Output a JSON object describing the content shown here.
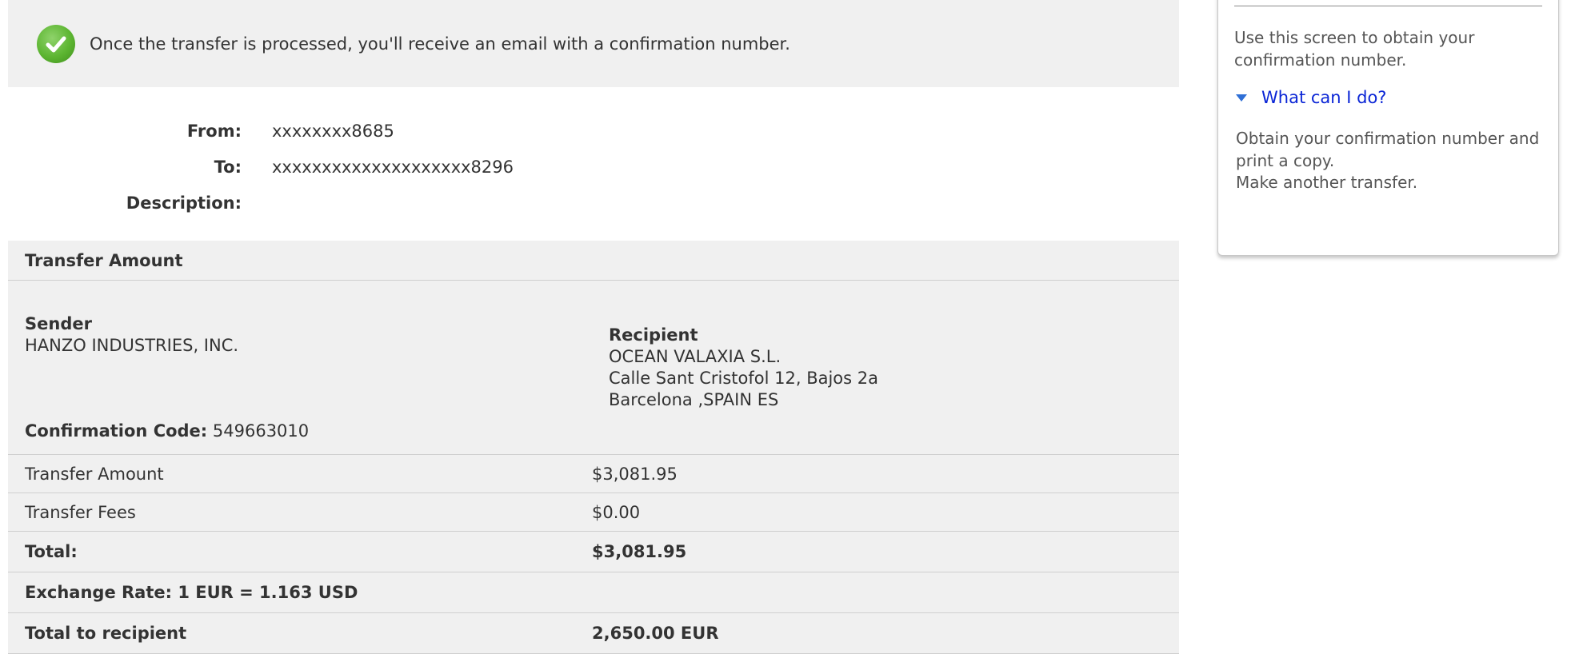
{
  "notice": {
    "text": "Once the transfer is processed, you'll receive an email with a confirmation number.",
    "icon": "checkmark-icon",
    "icon_color": "#5cb531"
  },
  "fields": {
    "from_label": "From:",
    "from_value": "xxxxxxxx8685",
    "to_label": "To:",
    "to_value": "xxxxxxxxxxxxxxxxxxxx8296",
    "description_label": "Description:",
    "description_value": ""
  },
  "summary": {
    "header": "Transfer Amount",
    "sender": {
      "label": "Sender",
      "name": "HANZO INDUSTRIES, INC."
    },
    "recipient": {
      "label": "Recipient",
      "name": "OCEAN VALAXIA S.L.",
      "address_line1": "Calle Sant Cristofol 12, Bajos 2a",
      "address_line2": "Barcelona ,SPAIN ES"
    },
    "confirmation": {
      "label": "Confirmation Code:",
      "value": "549663010"
    },
    "rows": {
      "transfer_amount_label": "Transfer Amount",
      "transfer_amount_value": "$3,081.95",
      "transfer_fees_label": "Transfer Fees",
      "transfer_fees_value": "$0.00",
      "total_label": "Total:",
      "total_value": "$3,081.95",
      "exchange_rate_label": "Exchange Rate: 1 EUR = 1.163 USD",
      "total_recipient_label": "Total to recipient",
      "total_recipient_value": "2,650.00 EUR"
    }
  },
  "sidebar": {
    "intro": "Use this screen to obtain your confirmation number.",
    "toggle_label": "What can I do?",
    "toggle_icon": "triangle-down-icon",
    "link_color": "#0a25d6",
    "item1": "Obtain your confirmation number and print a copy.",
    "item2": "Make another transfer."
  }
}
